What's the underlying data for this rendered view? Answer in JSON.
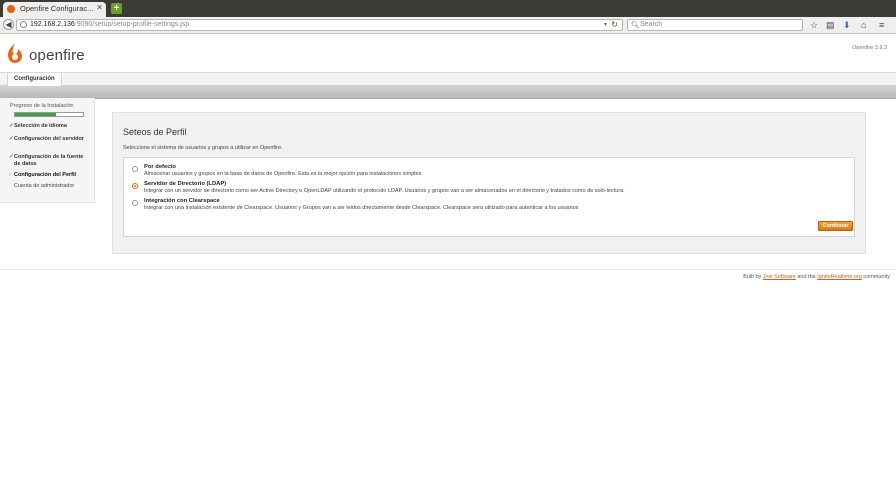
{
  "browser": {
    "tab_title": "Openfire Configurac...",
    "url_host": "192.168.2.136",
    "url_rest": ":9090/setup/setup-profile-settings.jsp",
    "search_placeholder": "Search"
  },
  "header": {
    "logo_text": "openfire",
    "version": "Openfire 3.9.3"
  },
  "topnav": {
    "tab": "Configuración"
  },
  "sidebar": {
    "title": "Progreso de la Instalación",
    "progress": 0.6,
    "items": [
      {
        "label": "Selección de idioma",
        "state": "done"
      },
      {
        "label": "Configuración del servidor",
        "state": "done"
      },
      {
        "label": "Configuración de la fuente de datos",
        "state": "done"
      },
      {
        "label": "Configuración del Perfil",
        "state": "current"
      },
      {
        "label": "Cuenta de administrador",
        "state": "pending"
      }
    ]
  },
  "main": {
    "title": "Seteos de Perfil",
    "description": "Seleccione el sistema de usuarios y grupos a utilizar en Openfire.",
    "options": [
      {
        "label": "Por defecto",
        "desc": "Almacenar usuarios y grupos en la base de datos de Openfire. Esta es la mejor opción para instalaciones simples.",
        "checked": false
      },
      {
        "label": "Servidor de Directorio (LDAP)",
        "desc": "Integrar con un servidor de directorio como ser Active Directory o OpenLDAP utilizando el protocolo LDAP. Usuarios y grupos van a ser almacenados en el directorio y tratados como de solo-lectura.",
        "checked": true
      },
      {
        "label": "Integración con Clearspace",
        "desc": "Integrar con una instalación existente de Clearspace. Usuarios y Grupos van a ser leidos directamente desde Clearspace. Clearspace sera utilizado para autenticar a los usuarios",
        "checked": false
      }
    ],
    "continue_label": "Continuar"
  },
  "footer": {
    "prefix": "Built by",
    "link1": "Jive Software",
    "middle": "and the",
    "link2": "IgniteRealtime.org",
    "suffix": "community"
  }
}
